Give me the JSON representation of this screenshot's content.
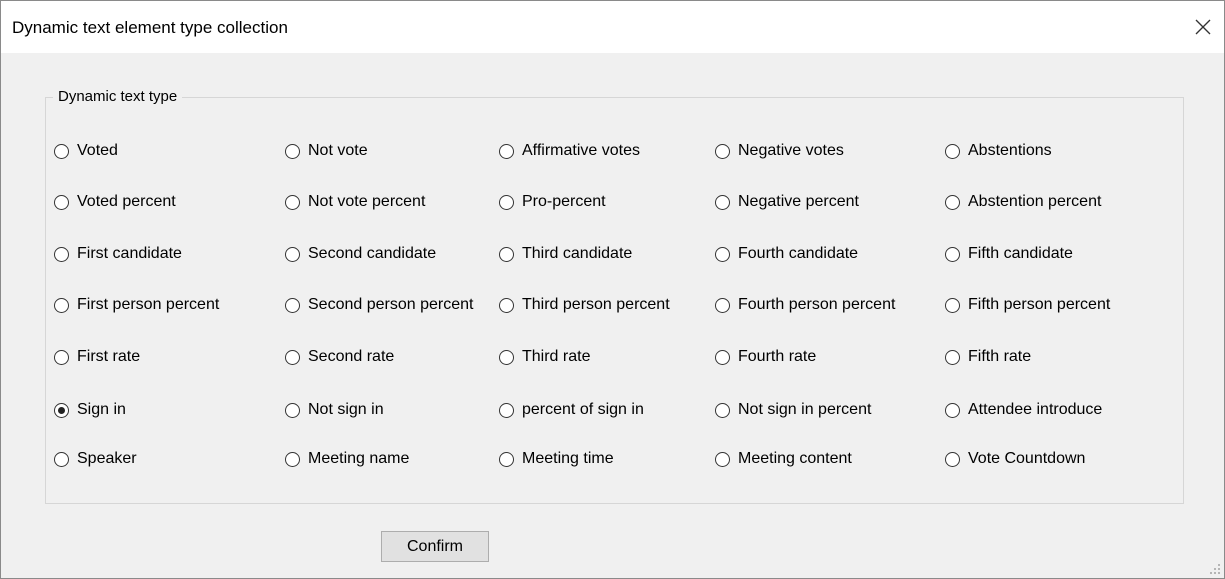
{
  "window": {
    "title": "Dynamic text element type collection"
  },
  "group": {
    "legend": "Dynamic text type"
  },
  "options": [
    [
      "Voted",
      "Not vote",
      "Affirmative votes",
      "Negative votes",
      "Abstentions"
    ],
    [
      "Voted percent",
      "Not vote percent",
      "Pro-percent",
      "Negative percent",
      "Abstention percent"
    ],
    [
      "First candidate",
      "Second candidate",
      "Third candidate",
      "Fourth candidate",
      "Fifth candidate"
    ],
    [
      "First person percent",
      "Second person percent",
      "Third person percent",
      "Fourth person percent",
      "Fifth person percent"
    ],
    [
      "First rate",
      "Second rate",
      "Third rate",
      "Fourth rate",
      "Fifth rate"
    ],
    [
      "Sign in",
      "Not sign in",
      "percent of sign in",
      "Not sign in percent",
      "Attendee introduce"
    ],
    [
      "Speaker",
      "Meeting name",
      "Meeting time",
      "Meeting content",
      "Vote Countdown"
    ]
  ],
  "selected": "Sign in",
  "buttons": {
    "confirm": "Confirm"
  },
  "icons": {
    "close": "close-icon",
    "resize": "resize-grip-icon"
  }
}
